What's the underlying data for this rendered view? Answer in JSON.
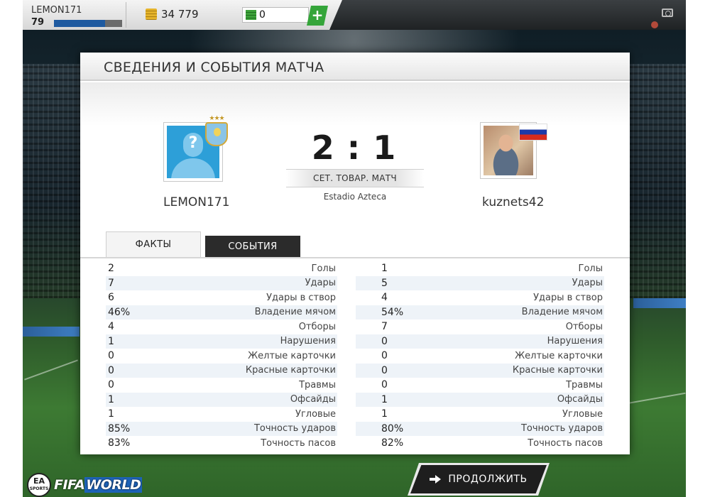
{
  "topbar": {
    "player_name": "LEMON171",
    "player_level": "79",
    "xp_progress": 0.75,
    "coins": "34 779",
    "cash": "0",
    "add_label": "+"
  },
  "panel": {
    "title": "СВЕДЕНИЯ И СОБЫТИЯ МАТЧА"
  },
  "match": {
    "home_name": "LEMON171",
    "away_name": "kuznets42",
    "home_score": "2",
    "away_score": "1",
    "separator": ":",
    "match_type": "СЕТ. ТОВАР. МАТЧ",
    "stadium": "Estadio Azteca",
    "away_flag": "Russia"
  },
  "tabs": {
    "facts": "ФАКТЫ",
    "events": "СОБЫТИЯ",
    "active": "facts"
  },
  "stats": {
    "home": [
      {
        "value": "2",
        "label": "Голы"
      },
      {
        "value": "7",
        "label": "Удары"
      },
      {
        "value": "6",
        "label": "Удары в створ"
      },
      {
        "value": "46%",
        "label": "Владение мячом"
      },
      {
        "value": "4",
        "label": "Отборы"
      },
      {
        "value": "1",
        "label": "Нарушения"
      },
      {
        "value": "0",
        "label": "Желтые карточки"
      },
      {
        "value": "0",
        "label": "Красные карточки"
      },
      {
        "value": "0",
        "label": "Травмы"
      },
      {
        "value": "1",
        "label": "Офсайды"
      },
      {
        "value": "1",
        "label": "Угловые"
      },
      {
        "value": "85%",
        "label": "Точность ударов"
      },
      {
        "value": "83%",
        "label": "Точность пасов"
      }
    ],
    "away": [
      {
        "value": "1",
        "label": "Голы"
      },
      {
        "value": "5",
        "label": "Удары"
      },
      {
        "value": "4",
        "label": "Удары в створ"
      },
      {
        "value": "54%",
        "label": "Владение мячом"
      },
      {
        "value": "7",
        "label": "Отборы"
      },
      {
        "value": "0",
        "label": "Нарушения"
      },
      {
        "value": "0",
        "label": "Желтые карточки"
      },
      {
        "value": "0",
        "label": "Красные карточки"
      },
      {
        "value": "0",
        "label": "Травмы"
      },
      {
        "value": "1",
        "label": "Офсайды"
      },
      {
        "value": "1",
        "label": "Угловые"
      },
      {
        "value": "80%",
        "label": "Точность ударов"
      },
      {
        "value": "82%",
        "label": "Точность пасов"
      }
    ]
  },
  "footer": {
    "ea_label": "EA",
    "ea_sub": "SPORTS",
    "brand_fifa": "FIFA",
    "brand_world": "WORLD",
    "continue_label": "ПРОДОЛЖИТЬ"
  },
  "colors": {
    "accent_blue": "#1f5aa0",
    "cash_green": "#35a53a",
    "button_dark": "#1e1e1e"
  }
}
